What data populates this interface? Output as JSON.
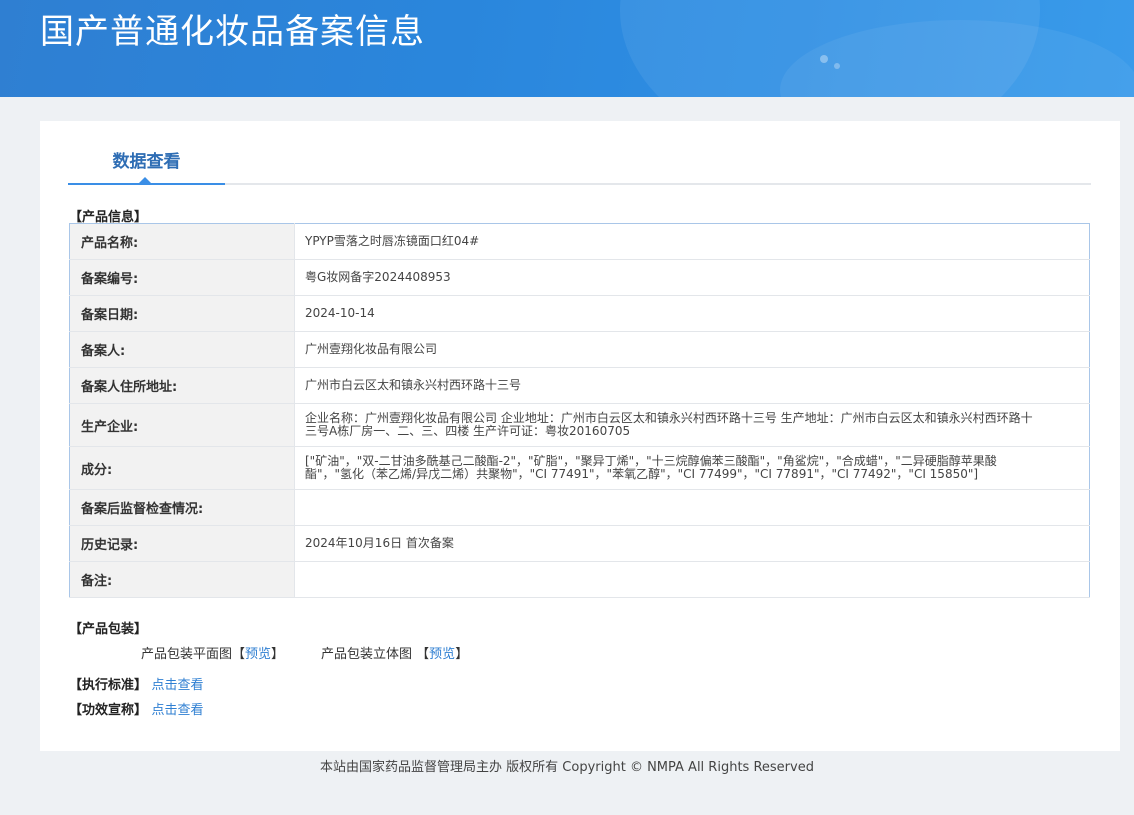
{
  "header": {
    "title": "国产普通化妆品备案信息",
    "colors": {
      "banner": "#2a86dc",
      "accent": "#3a8ee6",
      "link": "#2f7fd2"
    }
  },
  "tabs": [
    {
      "label": "数据查看",
      "active": true
    }
  ],
  "product_info": {
    "section_title": "【产品信息】",
    "rows": [
      {
        "label": "产品名称:",
        "value": "YPYP雪落之时唇冻镜面口红04#"
      },
      {
        "label": "备案编号:",
        "value": "粤G妆网备字2024408953"
      },
      {
        "label": "备案日期:",
        "value": "2024-10-14"
      },
      {
        "label": "备案人:",
        "value": "广州壹翔化妆品有限公司"
      },
      {
        "label": "备案人住所地址:",
        "value": "广州市白云区太和镇永兴村西环路十三号"
      },
      {
        "label": "生产企业:",
        "value": "企业名称：广州壹翔化妆品有限公司 企业地址：广州市白云区太和镇永兴村西环路十三号 生产地址：广州市白云区太和镇永兴村西环路十三号A栋厂房一、二、三、四楼 生产许可证：粤妆20160705"
      },
      {
        "label": "成分:",
        "value": "[\"矿油\"，\"双-二甘油多酰基己二酸酯-2\"，\"矿脂\"，\"聚异丁烯\"，\"十三烷醇偏苯三酸酯\"，\"角鲨烷\"，\"合成蜡\"，\"二异硬脂醇苹果酸酯\"，\"氢化（苯乙烯/异戊二烯）共聚物\"，\"CI 77491\"，\"苯氧乙醇\"，\"CI 77499\"，\"CI 77891\"，\"CI 77492\"，\"CI 15850\"]"
      },
      {
        "label": "备案后监督检查情况:",
        "value": ""
      },
      {
        "label": "历史记录:",
        "value": "2024年10月16日 首次备案"
      },
      {
        "label": "备注:",
        "value": ""
      }
    ]
  },
  "packaging": {
    "section_title": "【产品包装】",
    "flat_label": "产品包装平面图",
    "three_d_label": "产品包装立体图",
    "bracket_open": "【",
    "bracket_close": "】",
    "preview_link": "预览"
  },
  "standard": {
    "label": "【执行标准】",
    "link": "点击查看"
  },
  "efficacy": {
    "label": "【功效宣称】",
    "link": "点击查看"
  },
  "footer": {
    "text": "本站由国家药品监督管理局主办 版权所有 Copyright © NMPA All Rights Reserved"
  }
}
